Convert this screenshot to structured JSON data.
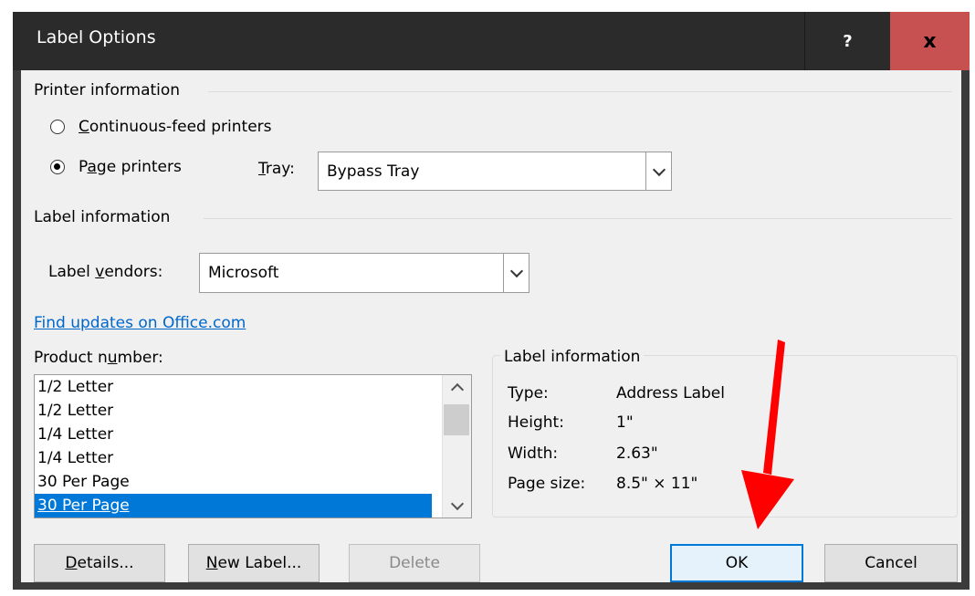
{
  "window": {
    "title": "Label Options",
    "help_label": "?",
    "close_label": "x"
  },
  "printer_info": {
    "title": "Printer information",
    "continuous_prefix": "C",
    "continuous_rest": "ontinuous-feed printers",
    "page_prefix": "P",
    "page_u": "a",
    "page_rest": "ge printers",
    "tray_u": "T",
    "tray_rest": "ray:",
    "tray_value": "Bypass Tray",
    "selected": "page"
  },
  "label_info_section": {
    "title": "Label information",
    "vendors_prefix": "Label ",
    "vendors_u": "v",
    "vendors_rest": "endors:",
    "vendor_value": "Microsoft"
  },
  "link": {
    "text": "Find updates on Office.com"
  },
  "product": {
    "label_prefix": "Product n",
    "label_u": "u",
    "label_rest": "mber:",
    "items": [
      "1/2 Letter",
      "1/2 Letter",
      "1/4 Letter",
      "1/4 Letter",
      "30 Per Page",
      "30 Per Page"
    ],
    "selected_index": 5
  },
  "details_box": {
    "title": "Label information",
    "type_label": "Type:",
    "type_value": "Address Label",
    "height_label": "Height:",
    "height_value": "1\"",
    "width_label": "Width:",
    "width_value": "2.63\"",
    "pagesize_label": "Page size:",
    "pagesize_value": "8.5\" × 11\""
  },
  "buttons": {
    "details_u": "D",
    "details_rest": "etails...",
    "new_label_u": "N",
    "new_label_rest": "ew Label...",
    "delete": "Delete",
    "ok": "OK",
    "cancel": "Cancel"
  },
  "colors": {
    "accent": "#0078d7",
    "close": "#c75050",
    "link": "#0066cc",
    "arrow": "#ff0000"
  }
}
